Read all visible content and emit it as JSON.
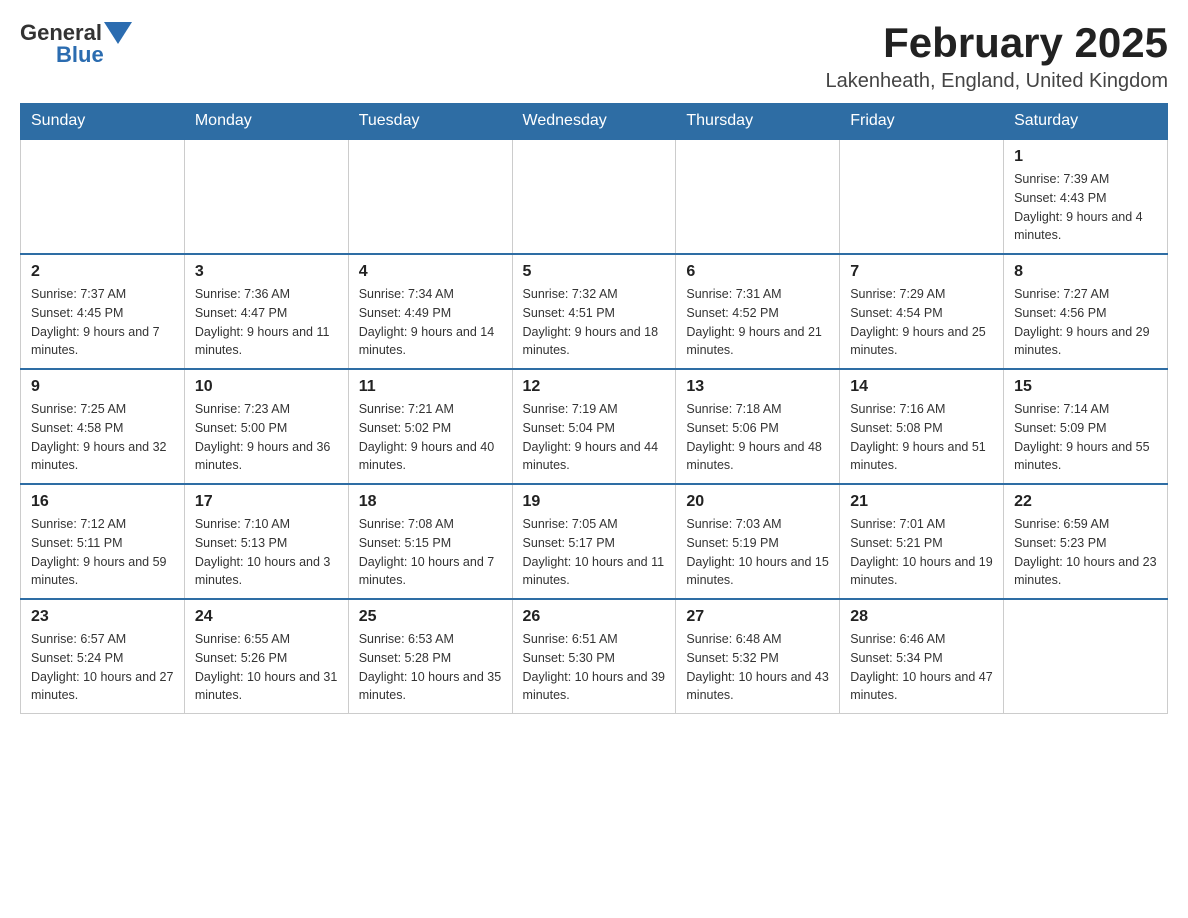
{
  "header": {
    "logo_general": "General",
    "logo_blue": "Blue",
    "month_title": "February 2025",
    "location": "Lakenheath, England, United Kingdom"
  },
  "days_of_week": [
    "Sunday",
    "Monday",
    "Tuesday",
    "Wednesday",
    "Thursday",
    "Friday",
    "Saturday"
  ],
  "weeks": [
    {
      "days": [
        {
          "date": "",
          "info": ""
        },
        {
          "date": "",
          "info": ""
        },
        {
          "date": "",
          "info": ""
        },
        {
          "date": "",
          "info": ""
        },
        {
          "date": "",
          "info": ""
        },
        {
          "date": "",
          "info": ""
        },
        {
          "date": "1",
          "info": "Sunrise: 7:39 AM\nSunset: 4:43 PM\nDaylight: 9 hours and 4 minutes."
        }
      ]
    },
    {
      "days": [
        {
          "date": "2",
          "info": "Sunrise: 7:37 AM\nSunset: 4:45 PM\nDaylight: 9 hours and 7 minutes."
        },
        {
          "date": "3",
          "info": "Sunrise: 7:36 AM\nSunset: 4:47 PM\nDaylight: 9 hours and 11 minutes."
        },
        {
          "date": "4",
          "info": "Sunrise: 7:34 AM\nSunset: 4:49 PM\nDaylight: 9 hours and 14 minutes."
        },
        {
          "date": "5",
          "info": "Sunrise: 7:32 AM\nSunset: 4:51 PM\nDaylight: 9 hours and 18 minutes."
        },
        {
          "date": "6",
          "info": "Sunrise: 7:31 AM\nSunset: 4:52 PM\nDaylight: 9 hours and 21 minutes."
        },
        {
          "date": "7",
          "info": "Sunrise: 7:29 AM\nSunset: 4:54 PM\nDaylight: 9 hours and 25 minutes."
        },
        {
          "date": "8",
          "info": "Sunrise: 7:27 AM\nSunset: 4:56 PM\nDaylight: 9 hours and 29 minutes."
        }
      ]
    },
    {
      "days": [
        {
          "date": "9",
          "info": "Sunrise: 7:25 AM\nSunset: 4:58 PM\nDaylight: 9 hours and 32 minutes."
        },
        {
          "date": "10",
          "info": "Sunrise: 7:23 AM\nSunset: 5:00 PM\nDaylight: 9 hours and 36 minutes."
        },
        {
          "date": "11",
          "info": "Sunrise: 7:21 AM\nSunset: 5:02 PM\nDaylight: 9 hours and 40 minutes."
        },
        {
          "date": "12",
          "info": "Sunrise: 7:19 AM\nSunset: 5:04 PM\nDaylight: 9 hours and 44 minutes."
        },
        {
          "date": "13",
          "info": "Sunrise: 7:18 AM\nSunset: 5:06 PM\nDaylight: 9 hours and 48 minutes."
        },
        {
          "date": "14",
          "info": "Sunrise: 7:16 AM\nSunset: 5:08 PM\nDaylight: 9 hours and 51 minutes."
        },
        {
          "date": "15",
          "info": "Sunrise: 7:14 AM\nSunset: 5:09 PM\nDaylight: 9 hours and 55 minutes."
        }
      ]
    },
    {
      "days": [
        {
          "date": "16",
          "info": "Sunrise: 7:12 AM\nSunset: 5:11 PM\nDaylight: 9 hours and 59 minutes."
        },
        {
          "date": "17",
          "info": "Sunrise: 7:10 AM\nSunset: 5:13 PM\nDaylight: 10 hours and 3 minutes."
        },
        {
          "date": "18",
          "info": "Sunrise: 7:08 AM\nSunset: 5:15 PM\nDaylight: 10 hours and 7 minutes."
        },
        {
          "date": "19",
          "info": "Sunrise: 7:05 AM\nSunset: 5:17 PM\nDaylight: 10 hours and 11 minutes."
        },
        {
          "date": "20",
          "info": "Sunrise: 7:03 AM\nSunset: 5:19 PM\nDaylight: 10 hours and 15 minutes."
        },
        {
          "date": "21",
          "info": "Sunrise: 7:01 AM\nSunset: 5:21 PM\nDaylight: 10 hours and 19 minutes."
        },
        {
          "date": "22",
          "info": "Sunrise: 6:59 AM\nSunset: 5:23 PM\nDaylight: 10 hours and 23 minutes."
        }
      ]
    },
    {
      "days": [
        {
          "date": "23",
          "info": "Sunrise: 6:57 AM\nSunset: 5:24 PM\nDaylight: 10 hours and 27 minutes."
        },
        {
          "date": "24",
          "info": "Sunrise: 6:55 AM\nSunset: 5:26 PM\nDaylight: 10 hours and 31 minutes."
        },
        {
          "date": "25",
          "info": "Sunrise: 6:53 AM\nSunset: 5:28 PM\nDaylight: 10 hours and 35 minutes."
        },
        {
          "date": "26",
          "info": "Sunrise: 6:51 AM\nSunset: 5:30 PM\nDaylight: 10 hours and 39 minutes."
        },
        {
          "date": "27",
          "info": "Sunrise: 6:48 AM\nSunset: 5:32 PM\nDaylight: 10 hours and 43 minutes."
        },
        {
          "date": "28",
          "info": "Sunrise: 6:46 AM\nSunset: 5:34 PM\nDaylight: 10 hours and 47 minutes."
        },
        {
          "date": "",
          "info": ""
        }
      ]
    }
  ]
}
